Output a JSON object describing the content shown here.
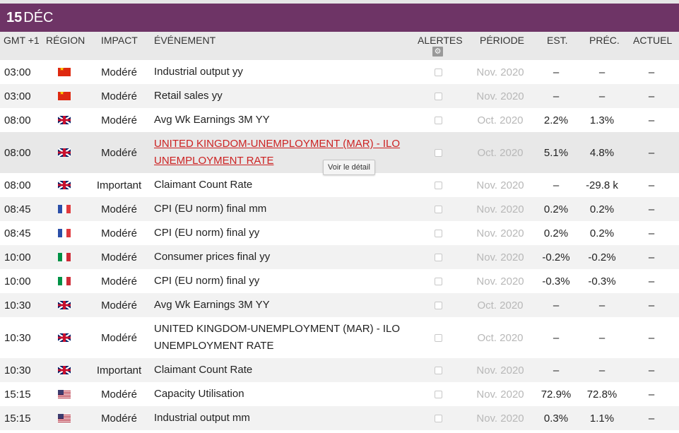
{
  "header": {
    "day": "15",
    "month": "DÉC"
  },
  "columns": {
    "time": "GMT +1",
    "region": "RÉGION",
    "impact": "IMPACT",
    "event": "ÉVÉNEMENT",
    "alerts": "ALERTES",
    "period": "PÉRIODE",
    "est": "EST.",
    "prev": "PRÉC.",
    "actual": "ACTUEL"
  },
  "alerts_settings_icon": "gear-icon",
  "tooltip": "Voir le détail",
  "colors": {
    "header_bg": "#6e3466",
    "link": "#cc2222"
  },
  "rows": [
    {
      "time": "03:00",
      "region": "china-flag-icon",
      "impact": "Modéré",
      "event": "Industrial output yy",
      "period": "Nov. 2020",
      "est": "–",
      "prev": "–",
      "actual": "–"
    },
    {
      "time": "03:00",
      "region": "china-flag-icon",
      "impact": "Modéré",
      "event": "Retail sales yy",
      "period": "Nov. 2020",
      "est": "–",
      "prev": "–",
      "actual": "–"
    },
    {
      "time": "08:00",
      "region": "uk-flag-icon",
      "impact": "Modéré",
      "event": "Avg Wk Earnings 3M YY",
      "period": "Oct. 2020",
      "est": "2.2%",
      "prev": "1.3%",
      "actual": "–"
    },
    {
      "time": "08:00",
      "region": "uk-flag-icon",
      "impact": "Modéré",
      "event": "UNITED KINGDOM-UNEMPLOYMENT (MAR) - ILO UNEMPLOYMENT RATE",
      "period": "Oct. 2020",
      "est": "5.1%",
      "prev": "4.8%",
      "actual": "–"
    },
    {
      "time": "08:00",
      "region": "uk-flag-icon",
      "impact": "Important",
      "event": "Claimant Count Rate",
      "period": "Nov. 2020",
      "est": "–",
      "prev": "-29.8 k",
      "actual": "–"
    },
    {
      "time": "08:45",
      "region": "france-flag-icon",
      "impact": "Modéré",
      "event": "CPI (EU norm) final mm",
      "period": "Nov. 2020",
      "est": "0.2%",
      "prev": "0.2%",
      "actual": "–"
    },
    {
      "time": "08:45",
      "region": "france-flag-icon",
      "impact": "Modéré",
      "event": "CPI (EU norm) final yy",
      "period": "Nov. 2020",
      "est": "0.2%",
      "prev": "0.2%",
      "actual": "–"
    },
    {
      "time": "10:00",
      "region": "italy-flag-icon",
      "impact": "Modéré",
      "event": "Consumer prices final yy",
      "period": "Nov. 2020",
      "est": "-0.2%",
      "prev": "-0.2%",
      "actual": "–"
    },
    {
      "time": "10:00",
      "region": "italy-flag-icon",
      "impact": "Modéré",
      "event": "CPI (EU norm) final yy",
      "period": "Nov. 2020",
      "est": "-0.3%",
      "prev": "-0.3%",
      "actual": "–"
    },
    {
      "time": "10:30",
      "region": "uk-flag-icon",
      "impact": "Modéré",
      "event": "Avg Wk Earnings 3M YY",
      "period": "Oct. 2020",
      "est": "–",
      "prev": "–",
      "actual": "–"
    },
    {
      "time": "10:30",
      "region": "uk-flag-icon",
      "impact": "Modéré",
      "event": "UNITED KINGDOM-UNEMPLOYMENT (MAR) - ILO UNEMPLOYMENT RATE",
      "period": "Oct. 2020",
      "est": "–",
      "prev": "–",
      "actual": "–"
    },
    {
      "time": "10:30",
      "region": "uk-flag-icon",
      "impact": "Important",
      "event": "Claimant Count Rate",
      "period": "Nov. 2020",
      "est": "–",
      "prev": "–",
      "actual": "–"
    },
    {
      "time": "15:15",
      "region": "usa-flag-icon",
      "impact": "Modéré",
      "event": "Capacity Utilisation",
      "period": "Nov. 2020",
      "est": "72.9%",
      "prev": "72.8%",
      "actual": "–"
    },
    {
      "time": "15:15",
      "region": "usa-flag-icon",
      "impact": "Modéré",
      "event": "Industrial output mm",
      "period": "Nov. 2020",
      "est": "0.3%",
      "prev": "1.1%",
      "actual": "–"
    }
  ]
}
